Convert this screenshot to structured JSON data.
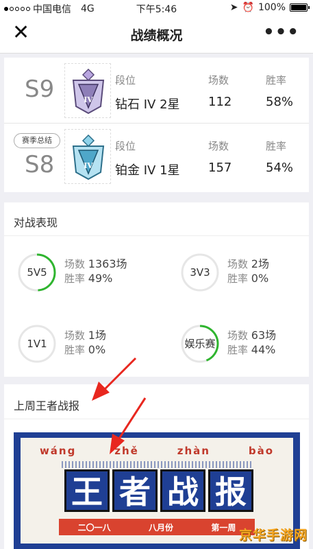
{
  "status_bar": {
    "carrier": "中国电信",
    "network": "4G",
    "time": "下午5:46",
    "battery": "100%"
  },
  "nav": {
    "close_label": "✕",
    "title": "战绩概况",
    "more_label": "•••"
  },
  "seasons": [
    {
      "badge": "",
      "code": "S9",
      "rank_label": "段位",
      "rank_value": "钻石 IV 2星",
      "games_label": "场数",
      "games_value": "112",
      "winrate_label": "胜率",
      "winrate_value": "58%",
      "rank_color": "#8e7fb8"
    },
    {
      "badge": "赛季总结",
      "code": "S8",
      "rank_label": "段位",
      "rank_value": "铂金 IV 1星",
      "games_label": "场数",
      "games_value": "157",
      "winrate_label": "胜率",
      "winrate_value": "54%",
      "rank_color": "#4fa7c9"
    }
  ],
  "battle": {
    "title": "对战表现",
    "games_label": "场数",
    "winrate_label": "胜率",
    "modes": [
      {
        "name": "5V5",
        "games": "1363场",
        "winrate": "49%",
        "ring_fraction": 0.49
      },
      {
        "name": "3V3",
        "games": "2场",
        "winrate": "0%",
        "ring_fraction": 0
      },
      {
        "name": "1V1",
        "games": "1场",
        "winrate": "0%",
        "ring_fraction": 0
      },
      {
        "name": "娱乐赛",
        "games": "63场",
        "winrate": "44%",
        "ring_fraction": 0.44
      }
    ],
    "ring_color": "#2fb52f"
  },
  "report": {
    "title": "上周王者战报",
    "pinyin": [
      "wáng",
      "zhě",
      "zhàn",
      "bào"
    ],
    "chars": [
      "王",
      "者",
      "战",
      "报"
    ],
    "ribbon": [
      "二〇一八",
      "八月份",
      "第一周"
    ]
  },
  "watermark": {
    "text": "京华手游网"
  }
}
